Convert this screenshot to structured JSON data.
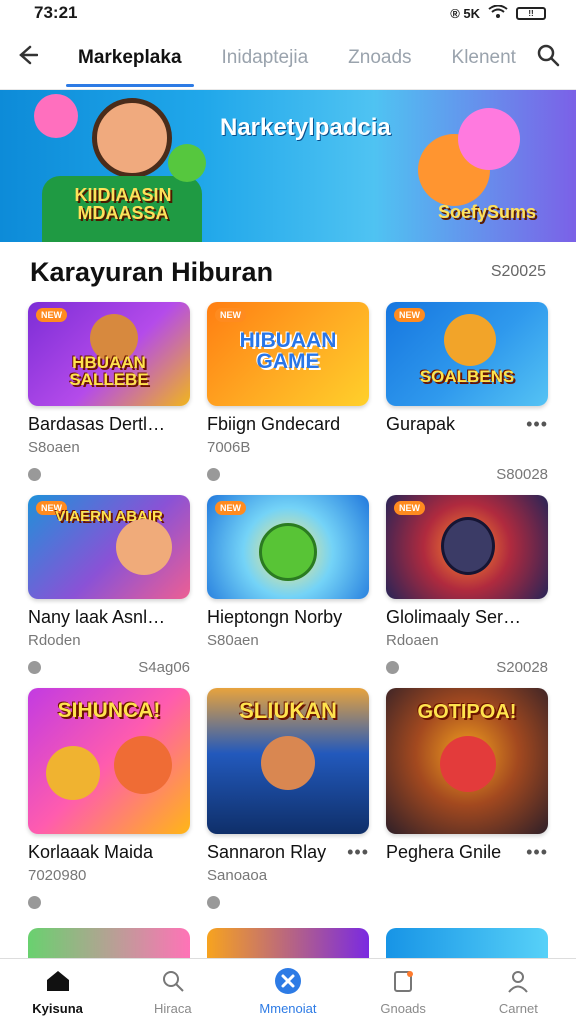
{
  "status": {
    "time": "73:21",
    "icons": "®  5K",
    "battery": "!!"
  },
  "nav": {
    "back_icon": "arrow-left-icon",
    "tabs": [
      "Markeplaka",
      "Inidaptejia",
      "Znoads",
      "Klenent"
    ],
    "search_icon": "search-icon"
  },
  "banner": {
    "title": "Narketylpadcia",
    "left_text": "KIIDIAASIN MDAASSA",
    "right_text": "SoefySums"
  },
  "section": {
    "title": "Karayuran Hiburan",
    "right_text": "S20025"
  },
  "cards": [
    {
      "name": "Bardasas Dertlngn",
      "sub": "S8oaen",
      "price": "",
      "more": "",
      "thumb_text": "HBUAAN SALLEBE",
      "colors": [
        "#7c2dd6",
        "#f0b51d"
      ]
    },
    {
      "name": "Fbiign Gndecard",
      "sub": "7006B",
      "price": "",
      "more": "",
      "thumb_text": "HIBUAAN GAME",
      "colors": [
        "#ff7e12",
        "#ffd02b"
      ]
    },
    {
      "name": "Gurapak",
      "sub": "",
      "price": "S80028",
      "more": "•••",
      "thumb_text": "SOALBENS",
      "colors": [
        "#1676df",
        "#55c3f4"
      ]
    },
    {
      "name": "Nany laak Asnlan...",
      "sub": "Rdoden",
      "price": "S4ag06",
      "more": "",
      "thumb_text": "VIAERN ABAIR",
      "colors": [
        "#1f91d9",
        "#ed5f93"
      ]
    },
    {
      "name": "Hieptongn Norby",
      "sub": "S80aen",
      "price": "",
      "more": "",
      "thumb_text": "",
      "colors": [
        "#2178dc",
        "#74d3f7"
      ]
    },
    {
      "name": "Glolimaaly Serolan",
      "sub": "Rdoaen",
      "price": "S20028",
      "more": "",
      "thumb_text": "",
      "colors": [
        "#272457",
        "#ff5b19"
      ]
    },
    {
      "name": "Korlaaak Maida",
      "sub": "7020980",
      "price": "",
      "more": "",
      "thumb_text": "SIHUNCA!",
      "colors": [
        "#c23be2",
        "#ffb616"
      ]
    },
    {
      "name": "Sannaron Rlay",
      "sub": "Sanoaoa",
      "price": "",
      "more": "•••",
      "thumb_text": "SLIUKAN",
      "colors": [
        "#2259bc",
        "#d99b31"
      ]
    },
    {
      "name": "Peghera Gnile",
      "sub": "",
      "price": "",
      "more": "•••",
      "thumb_text": "GOTIPOA!",
      "colors": [
        "#2e1f28",
        "#f3a11f"
      ]
    }
  ],
  "bottom_nav": [
    {
      "label": "Kyisuna",
      "icon": "home-icon"
    },
    {
      "label": "Hiraca",
      "icon": "search-icon"
    },
    {
      "label": "Mmenoiat",
      "icon": "close-icon"
    },
    {
      "label": "Gnoads",
      "icon": "tablet-icon"
    },
    {
      "label": "Carnet",
      "icon": "profile-icon"
    }
  ]
}
